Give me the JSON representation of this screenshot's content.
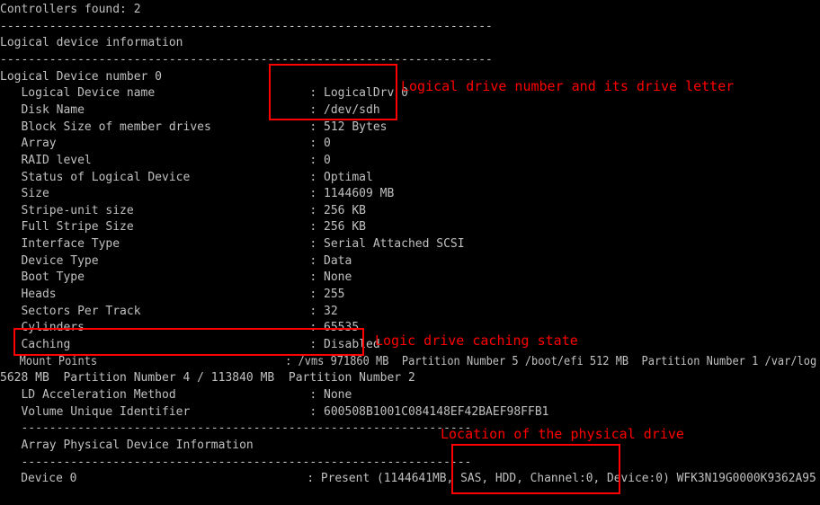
{
  "terminal": {
    "text_color": "#c0c0c0",
    "background": "#000000",
    "lines": [
      "Controllers found: 2",
      "----------------------------------------------------------------------",
      "Logical device information",
      "----------------------------------------------------------------------",
      "Logical Device number 0",
      "   Logical Device name                      : LogicalDrv 0",
      "   Disk Name                                : /dev/sdh",
      "   Block Size of member drives              : 512 Bytes",
      "   Array                                    : 0",
      "   RAID level                               : 0",
      "   Status of Logical Device                 : Optimal",
      "   Size                                     : 1144609 MB",
      "   Stripe-unit size                         : 256 KB",
      "   Full Stripe Size                         : 256 KB",
      "   Interface Type                           : Serial Attached SCSI",
      "   Device Type                              : Data",
      "   Boot Type                                : None",
      "   Heads                                    : 255",
      "   Sectors Per Track                        : 32",
      "   Cylinders                                : 65535",
      "   Caching                                  : Disabled",
      "   Mount Points                             : /vms 971860 MB  Partition Number 5 /boot/efi 512 MB  Partition Number 1 /var/log",
      "5628 MB  Partition Number 4 / 113840 MB  Partition Number 2",
      "   LD Acceleration Method                   : None",
      "   Volume Unique Identifier                 : 600508B1001C084148EF42BAEF98FFB1",
      "   ----------------------------------------------------------------",
      "   Array Physical Device Information",
      "   ----------------------------------------------------------------",
      "   Device 0                                 : Present (1144641MB, SAS, HDD, Channel:0, Device:0) WFK3N19G0000K9362A95"
    ]
  },
  "annotations": {
    "color": "#ff0000",
    "drive_number": "Logical drive number and its drive letter",
    "caching": "Logic drive caching state",
    "physical_location": "Location of the physical drive"
  }
}
